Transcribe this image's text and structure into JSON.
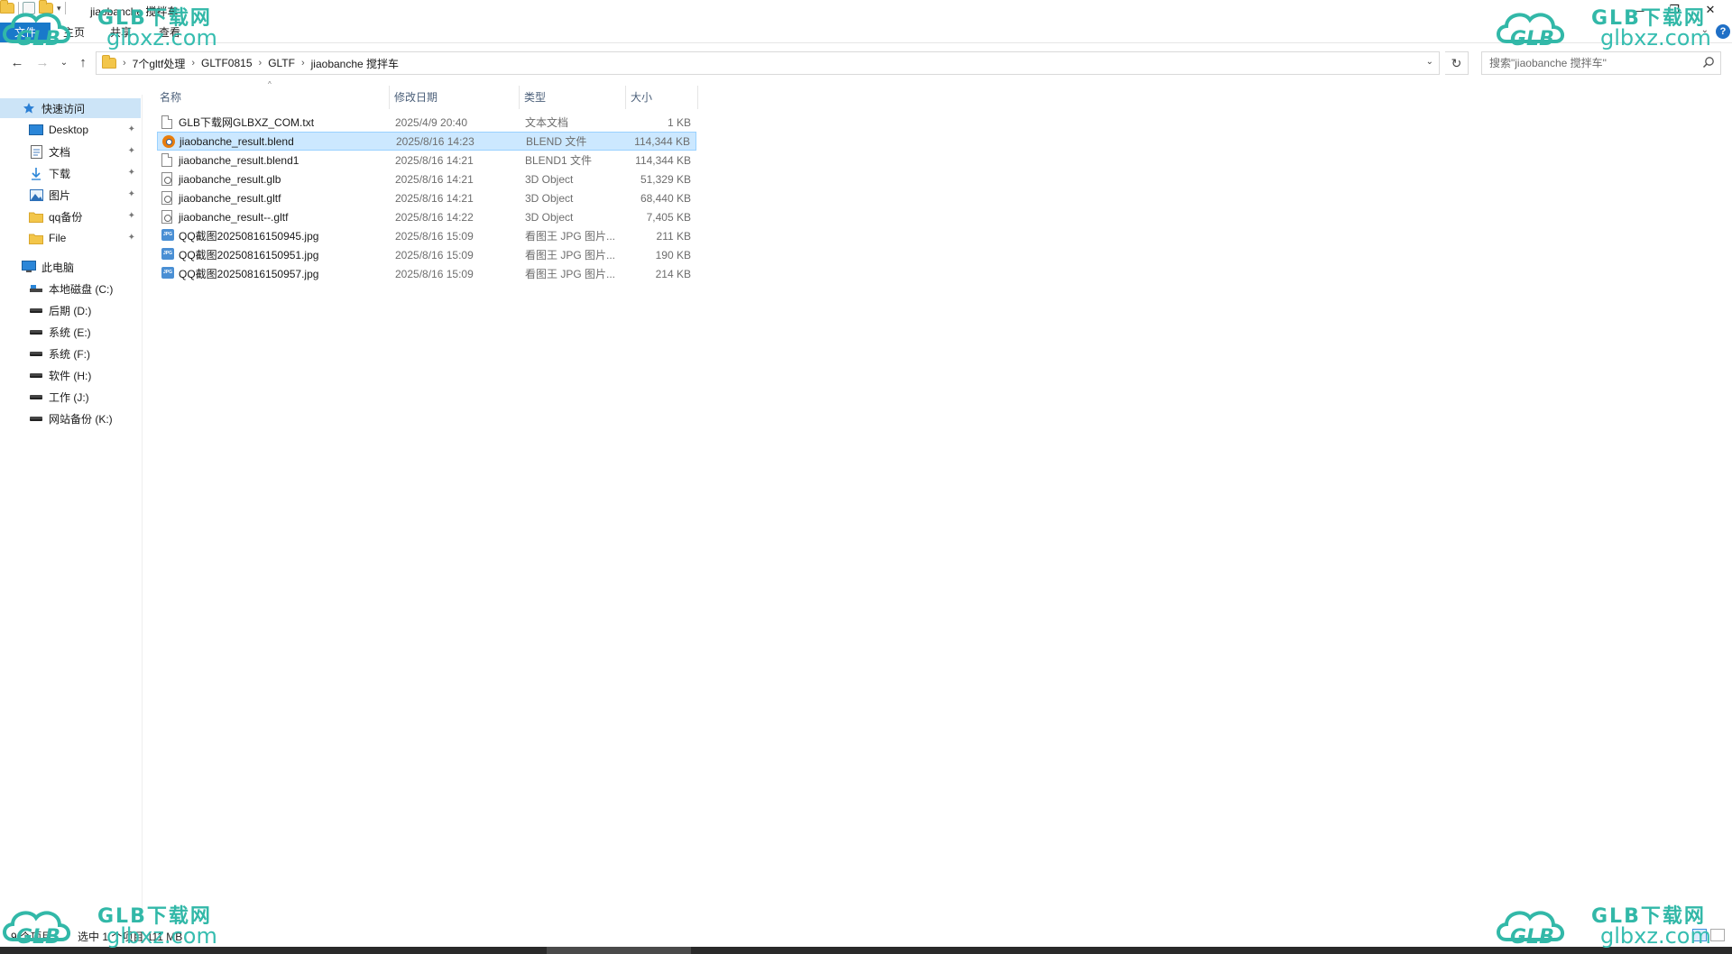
{
  "window": {
    "title": "jiaobanche 搅拌车",
    "min_glyph": "—",
    "max_glyph": "❐",
    "close_glyph": "✕"
  },
  "ribbon": {
    "tabs": [
      "文件",
      "主页",
      "共享",
      "查看"
    ],
    "help_glyph": "?",
    "expand_glyph": "⌄",
    "accent_color": "#1979ca"
  },
  "nav_buttons": {
    "back_glyph": "←",
    "forward_glyph": "→",
    "recent_glyph": "⌄",
    "up_glyph": "↑"
  },
  "address": {
    "breadcrumbs": [
      "7个gltf处理",
      "GLTF0815",
      "GLTF",
      "jiaobanche 搅拌车"
    ],
    "separator": "›",
    "dropdown_glyph": "⌄",
    "refresh_glyph": "↻"
  },
  "search": {
    "placeholder": "搜索\"jiaobanche 搅拌车\""
  },
  "sidebar": {
    "quick_access": {
      "label": "快速访问",
      "icon": "star-icon"
    },
    "quick_items": [
      {
        "label": "Desktop",
        "icon": "desktop-icon",
        "pinned": true
      },
      {
        "label": "文档",
        "icon": "documents-icon",
        "pinned": true
      },
      {
        "label": "下载",
        "icon": "download-icon",
        "pinned": true
      },
      {
        "label": "图片",
        "icon": "pictures-icon",
        "pinned": true
      },
      {
        "label": "qq备份",
        "icon": "folder-icon",
        "pinned": true
      },
      {
        "label": "File",
        "icon": "folder-icon",
        "pinned": true
      }
    ],
    "this_pc": {
      "label": "此电脑",
      "icon": "computer-icon"
    },
    "drives": [
      {
        "label": "本地磁盘 (C:)",
        "icon": "system-drive-icon"
      },
      {
        "label": "后期 (D:)",
        "icon": "drive-icon"
      },
      {
        "label": "系统 (E:)",
        "icon": "drive-icon"
      },
      {
        "label": "系统 (F:)",
        "icon": "drive-icon"
      },
      {
        "label": "软件 (H:)",
        "icon": "drive-icon"
      },
      {
        "label": "工作 (J:)",
        "icon": "drive-icon"
      },
      {
        "label": "网站备份 (K:)",
        "icon": "drive-icon"
      }
    ],
    "pin_glyph": "📌"
  },
  "columns": {
    "name": "名称",
    "date": "修改日期",
    "type": "类型",
    "size": "大小",
    "sort_glyph": "^"
  },
  "files": [
    {
      "name": "GLB下载网GLBXZ_COM.txt",
      "date": "2025/4/9 20:40",
      "type": "文本文档",
      "size": "1 KB",
      "icon": "text-file-icon",
      "selected": false
    },
    {
      "name": "jiaobanche_result.blend",
      "date": "2025/8/16 14:23",
      "type": "BLEND 文件",
      "size": "114,344 KB",
      "icon": "blender-file-icon",
      "selected": true
    },
    {
      "name": "jiaobanche_result.blend1",
      "date": "2025/8/16 14:21",
      "type": "BLEND1 文件",
      "size": "114,344 KB",
      "icon": "generic-file-icon",
      "selected": false
    },
    {
      "name": "jiaobanche_result.glb",
      "date": "2025/8/16 14:21",
      "type": "3D Object",
      "size": "51,329 KB",
      "icon": "3d-object-icon",
      "selected": false
    },
    {
      "name": "jiaobanche_result.gltf",
      "date": "2025/8/16 14:21",
      "type": "3D Object",
      "size": "68,440 KB",
      "icon": "3d-object-icon",
      "selected": false
    },
    {
      "name": "jiaobanche_result--.gltf",
      "date": "2025/8/16 14:22",
      "type": "3D Object",
      "size": "7,405 KB",
      "icon": "3d-object-icon",
      "selected": false
    },
    {
      "name": "QQ截图20250816150945.jpg",
      "date": "2025/8/16 15:09",
      "type": "看图王 JPG 图片...",
      "size": "211 KB",
      "icon": "jpg-file-icon",
      "selected": false
    },
    {
      "name": "QQ截图20250816150951.jpg",
      "date": "2025/8/16 15:09",
      "type": "看图王 JPG 图片...",
      "size": "190 KB",
      "icon": "jpg-file-icon",
      "selected": false
    },
    {
      "name": "QQ截图20250816150957.jpg",
      "date": "2025/8/16 15:09",
      "type": "看图王 JPG 图片...",
      "size": "214 KB",
      "icon": "jpg-file-icon",
      "selected": false
    }
  ],
  "status": {
    "count": "9 个项目",
    "selection": "选中 1 个项目 111 MB"
  },
  "watermark": {
    "logo_text": "GLB",
    "brand": "GLB下载网",
    "site": "glbxz.com",
    "color": "#32b8a8"
  },
  "colors": {
    "selection_bg": "#cce8ff",
    "selection_border": "#99d1ff",
    "nav_selected_bg": "#cce4f7"
  }
}
